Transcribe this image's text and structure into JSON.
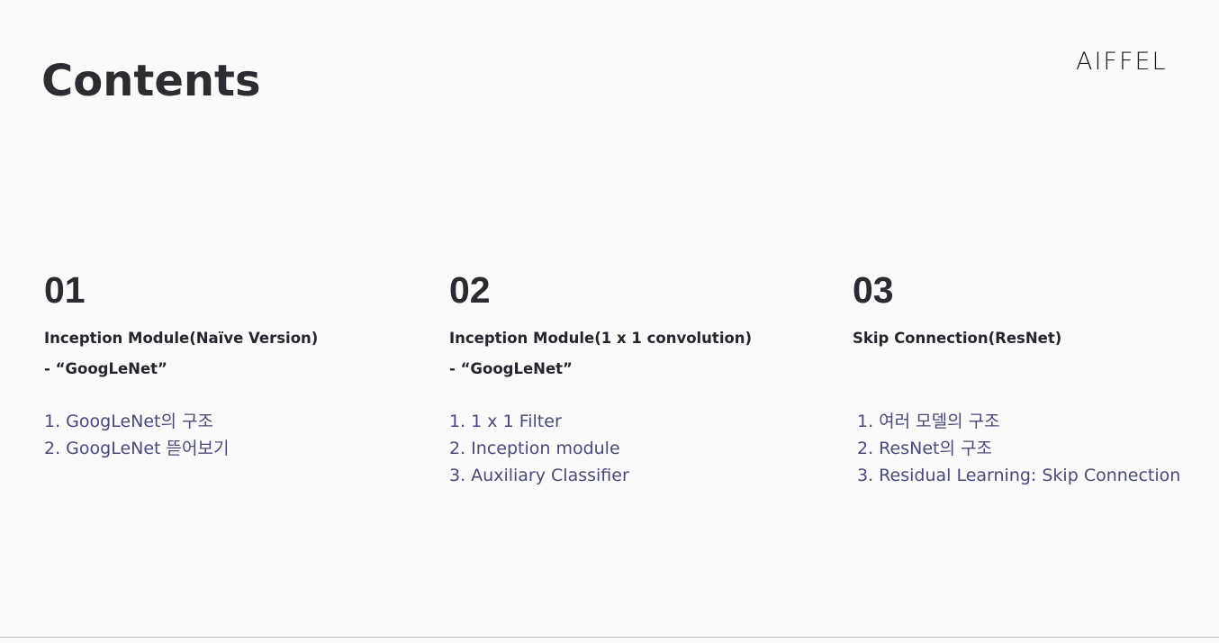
{
  "slide": {
    "title": "Contents",
    "logo": "AIFFEL"
  },
  "sections": [
    {
      "number": "01",
      "heading": "Inception Module(Naïve Version)",
      "subheading": "- “GoogLeNet”",
      "items": [
        "1. GoogLeNet의 구조",
        "2. GoogLeNet 뜯어보기"
      ]
    },
    {
      "number": "02",
      "heading": "Inception Module(1 x 1 convolution)",
      "subheading": "- “GoogLeNet”",
      "items": [
        "1. 1 x 1 Filter",
        "2. Inception module",
        "3. Auxiliary Classifier"
      ]
    },
    {
      "number": "03",
      "heading": "Skip Connection(ResNet)",
      "subheading": "",
      "items": [
        "1. 여러 모델의 구조",
        "2. ResNet의 구조",
        "3. Residual Learning: Skip Connection"
      ]
    }
  ]
}
